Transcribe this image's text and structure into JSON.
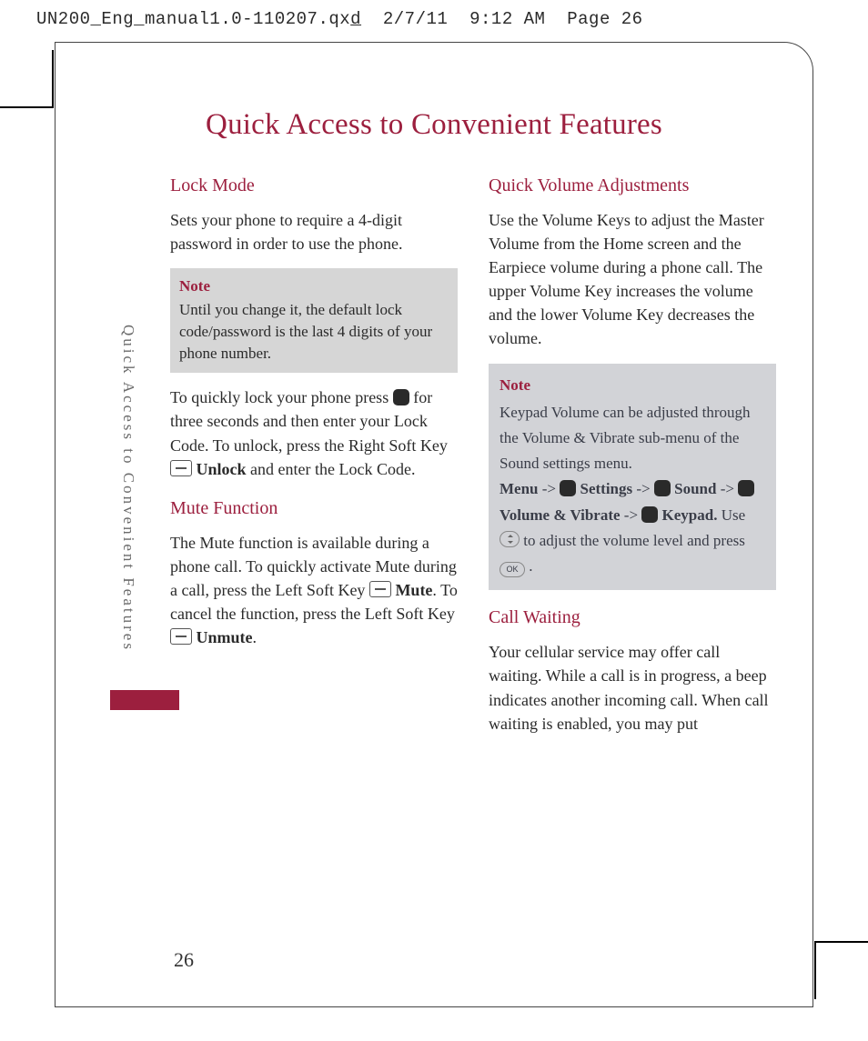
{
  "header": {
    "file": "UN200_Eng_manual1.0-110207.qx",
    "ext": "d",
    "date": "2/7/11",
    "time": "9:12 AM",
    "page": "Page 26"
  },
  "title": "Quick Access to Convenient Features",
  "side": "Quick Access to Convenient Features",
  "pagenum": "26",
  "left": {
    "h1": "Lock Mode",
    "p1": "Sets your phone to require a 4-digit password in order to use the phone.",
    "note_t": "Note",
    "note_b": "Until you change it, the default lock code/password is the last 4 digits of your phone number.",
    "p2a": "To quickly lock your phone press ",
    "p2b": " for three seconds and then enter your Lock Code. To unlock, press the Right Soft Key ",
    "p2c": "Unlock",
    "p2d": " and enter the Lock Code.",
    "h2": "Mute Function",
    "p3a": "The Mute function is available during a phone call. To quickly activate Mute during a call, press the Left Soft Key ",
    "p3b": "Mute",
    "p3c": ". To cancel the function, press the Left Soft Key ",
    "p3d": "Unmute",
    "p3e": "."
  },
  "right": {
    "h1": "Quick Volume Adjustments",
    "p1": "Use the Volume Keys to adjust the Master Volume from the Home screen and the Earpiece volume during a phone call. The upper Volume Key increases the volume and the lower Volume Key decreases the volume.",
    "note_t": "Note",
    "note_b1": "Keypad Volume can be adjusted through the Volume & Vibrate sub-menu of the Sound settings menu.",
    "m_menu": "Menu",
    "m_arrow": " -> ",
    "m_settings": "Settings",
    "m_sound": "Sound",
    "m_vol": "Volume & Vibrate",
    "m_key": "Keypad.",
    "m_use": " Use ",
    "m_adj": " to adjust the volume level and press ",
    "h2": "Call Waiting",
    "p2": "Your cellular service may offer call waiting. While a call is in progress, a beep indicates another incoming call. When call waiting is enabled, you may put"
  }
}
